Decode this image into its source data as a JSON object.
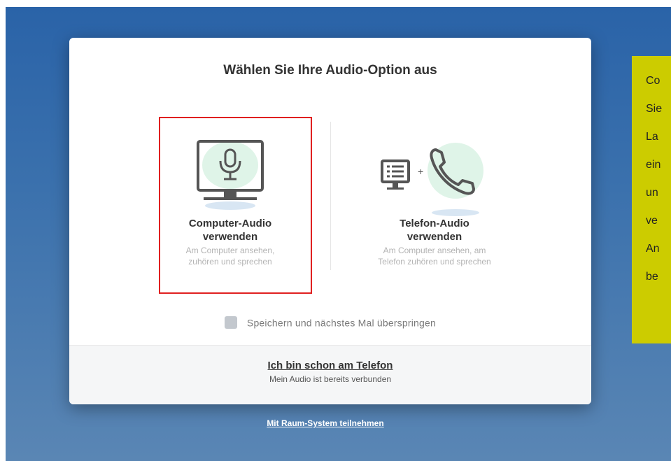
{
  "dialog": {
    "title": "Wählen Sie Ihre Audio-Option aus",
    "options": [
      {
        "title_line1": "Computer-Audio",
        "title_line2": "verwenden",
        "desc_line1": "Am Computer ansehen,",
        "desc_line2": "zuhören und sprechen",
        "icon": "monitor-microphone-icon"
      },
      {
        "title_line1": "Telefon-Audio",
        "title_line2": "verwenden",
        "desc_line1": "Am Computer ansehen, am",
        "desc_line2": "Telefon zuhören und sprechen",
        "icon": "computer-plus-phone-icon"
      }
    ],
    "checkbox_label": "Speichern und nächstes Mal überspringen",
    "footer_link": "Ich bin schon am Telefon",
    "footer_sub": "Mein Audio ist bereits verbunden"
  },
  "room_link": "Mit Raum-System teilnehmen",
  "note_lines": [
    "Co",
    "Sie",
    "La",
    "ein",
    "un",
    "ve",
    "An",
    "be"
  ],
  "colors": {
    "accent_green": "#7dd3a6",
    "highlight": "#e02020",
    "note_bg": "#cccc00"
  }
}
